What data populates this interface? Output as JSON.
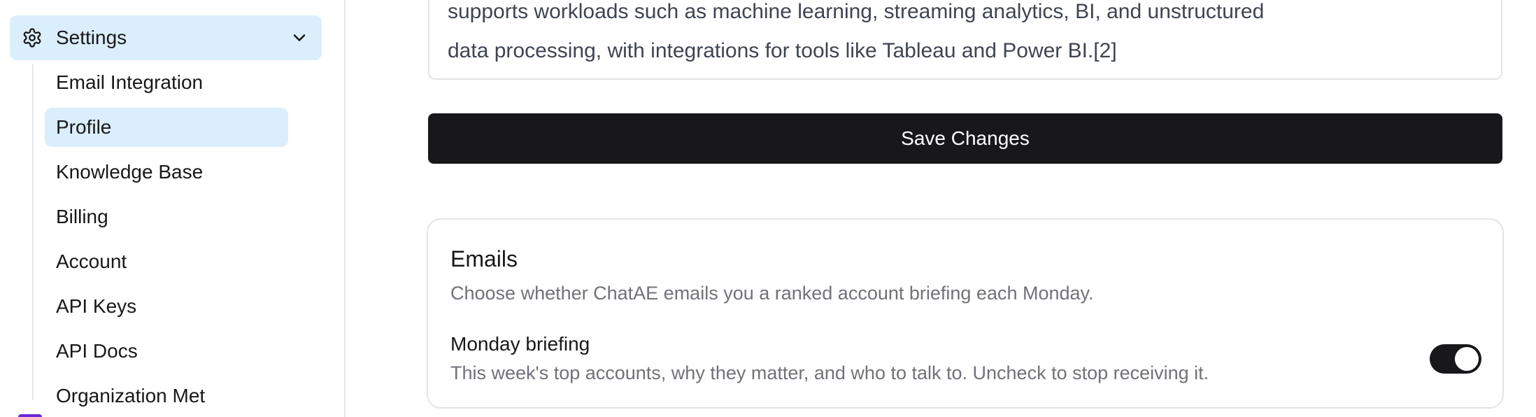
{
  "sidebar": {
    "settings_label": "Settings",
    "items": [
      {
        "label": "Email Integration",
        "active": false
      },
      {
        "label": "Profile",
        "active": true
      },
      {
        "label": "Knowledge Base",
        "active": false
      },
      {
        "label": "Billing",
        "active": false
      },
      {
        "label": "Account",
        "active": false
      },
      {
        "label": "API Keys",
        "active": false
      },
      {
        "label": "API Docs",
        "active": false
      },
      {
        "label": "Organization Met",
        "active": false
      }
    ]
  },
  "textarea": {
    "lines": [
      "supports workloads such as machine learning, streaming analytics, BI, and unstructured",
      "data processing, with integrations for tools like Tableau and Power BI.[2]"
    ]
  },
  "save_button": {
    "label": "Save Changes"
  },
  "emails": {
    "title": "Emails",
    "description": "Choose whether ChatAE emails you a ranked account briefing each Monday.",
    "monday_briefing": {
      "label": "Monday briefing",
      "description": "This week's top accounts, why they matter, and who to talk to. Uncheck to stop receiving it.",
      "enabled": true
    }
  },
  "colors": {
    "accent_bg": "#dbeefb",
    "primary": "#18181b",
    "muted_text": "#71717a"
  },
  "icons": {
    "settings": "gear-icon",
    "collapse": "chevron-down-icon"
  }
}
